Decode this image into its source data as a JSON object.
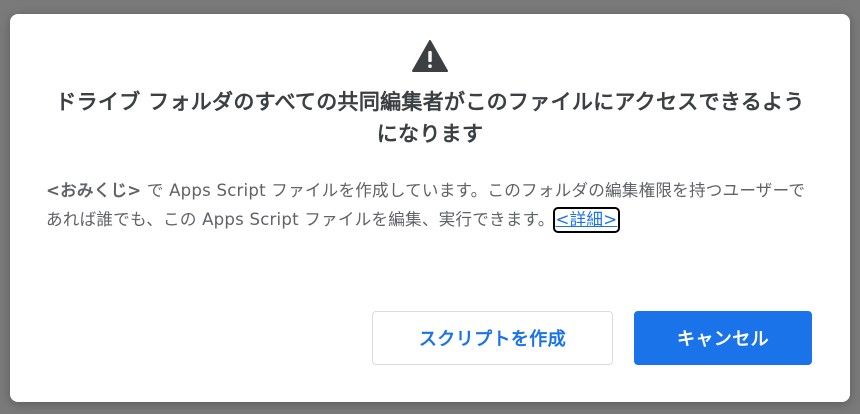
{
  "dialog": {
    "icon": "warning-icon",
    "title": "ドライブ フォルダのすべての共同編集者がこのファイルにアクセスできるようになります",
    "project_name": "<おみくじ>",
    "body_text": " で Apps Script ファイルを作成しています。このフォルダの編集権限を持つユーザーであれば誰でも、この Apps Script ファイルを編集、実行できます。",
    "details_link": "<詳細>",
    "create_button": "スクリプトを作成",
    "cancel_button": "キャンセル"
  },
  "colors": {
    "accent": "#1a73e8",
    "title_text": "#3c4043",
    "body_text": "#5f6368",
    "overlay": "#7a7a7a"
  }
}
